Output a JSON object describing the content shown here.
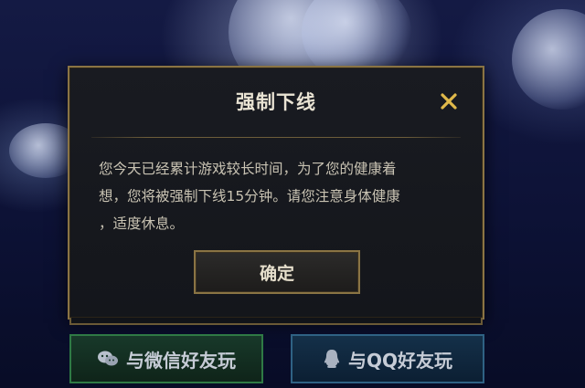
{
  "dialog": {
    "title": "强制下线",
    "close_icon": "close-icon",
    "message_lines": [
      "您今天已经累计游戏较长时间，为了您的健康着",
      "想，您将被强制下线15分钟。请您注意身体健康",
      "，适度休息。"
    ],
    "confirm_label": "确定"
  },
  "share": {
    "wechat_label": "与微信好友玩",
    "wechat_icon": "wechat-icon",
    "qq_label": "与QQ好友玩",
    "qq_icon": "qq-icon"
  },
  "colors": {
    "gold_border": "#8a7444",
    "close_icon": "#e0b94a",
    "wechat_accent": "#2f7a45",
    "qq_accent": "#2f6284"
  }
}
